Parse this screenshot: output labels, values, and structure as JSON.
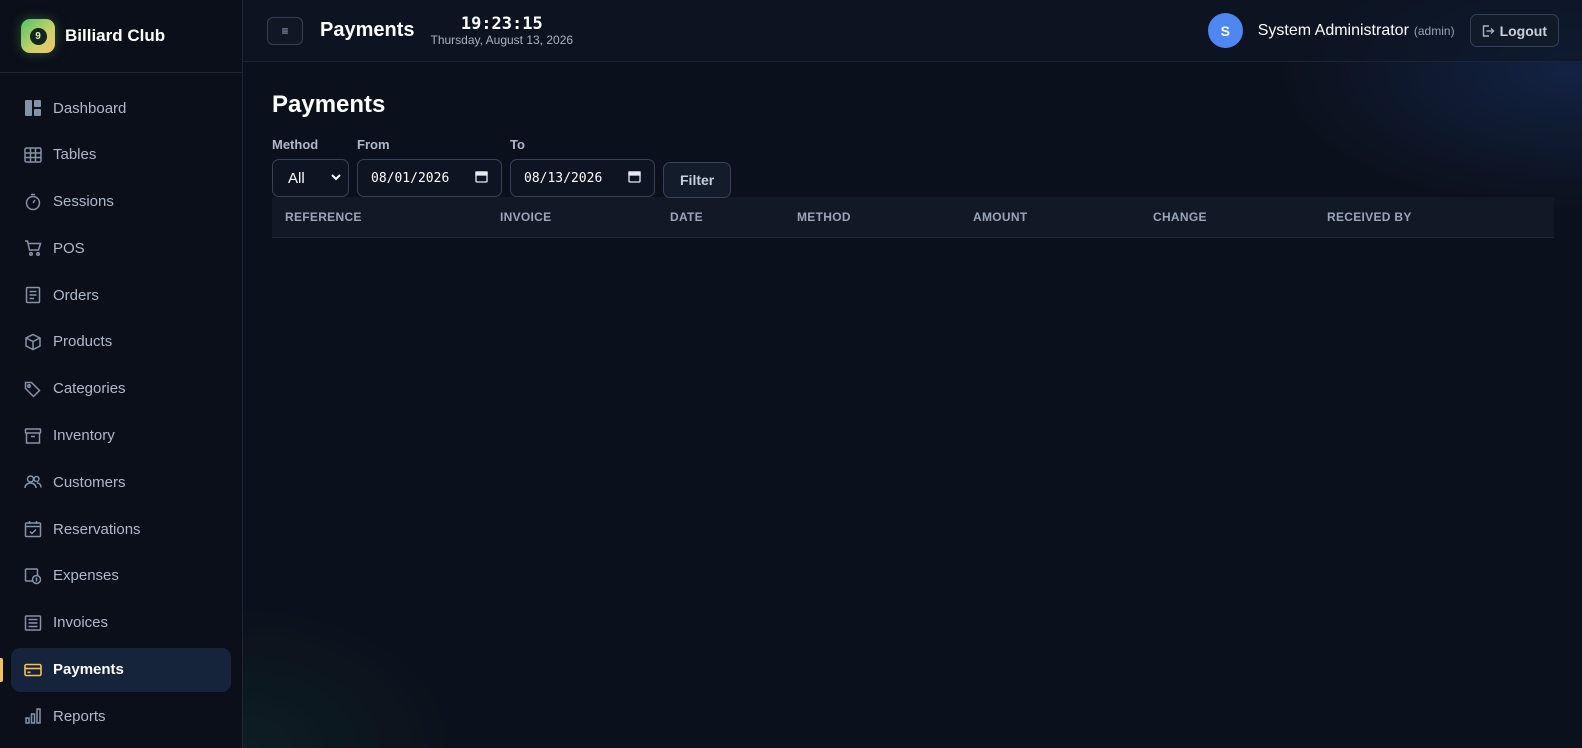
{
  "brand": {
    "name": "Billiard Club",
    "logo_glyph": "9",
    "logo_icon": "billiard-ball-icon"
  },
  "sidebar": {
    "items": [
      {
        "label": "Dashboard",
        "icon": "dashboard-icon"
      },
      {
        "label": "Tables",
        "icon": "table-grid-icon"
      },
      {
        "label": "Sessions",
        "icon": "stopwatch-icon"
      },
      {
        "label": "POS",
        "icon": "cart-icon"
      },
      {
        "label": "Orders",
        "icon": "receipt-icon"
      },
      {
        "label": "Products",
        "icon": "box-icon"
      },
      {
        "label": "Categories",
        "icon": "tag-icon"
      },
      {
        "label": "Inventory",
        "icon": "archive-icon"
      },
      {
        "label": "Customers",
        "icon": "users-icon"
      },
      {
        "label": "Reservations",
        "icon": "calendar-check-icon"
      },
      {
        "label": "Expenses",
        "icon": "expense-icon"
      },
      {
        "label": "Invoices",
        "icon": "invoice-icon"
      },
      {
        "label": "Payments",
        "icon": "credit-card-icon",
        "active": true
      },
      {
        "label": "Reports",
        "icon": "bar-chart-icon"
      }
    ],
    "active_color": "#f1c15c"
  },
  "topbar": {
    "menu_glyph": "≡",
    "title": "Payments",
    "clock_time": "19:23:15",
    "clock_date": "Thursday, August 13, 2026",
    "user_initial": "S",
    "user_name": "System Administrator",
    "user_role": "(admin)",
    "logout_label": "Logout"
  },
  "page": {
    "title": "Payments",
    "filters": {
      "method_label": "Method",
      "method_value": "All",
      "from_label": "From",
      "from_value": "08/01/2026",
      "to_label": "To",
      "to_value": "08/13/2026",
      "filter_button": "Filter"
    },
    "table": {
      "columns": [
        "REFERENCE",
        "INVOICE",
        "DATE",
        "METHOD",
        "AMOUNT",
        "CHANGE",
        "RECEIVED BY"
      ],
      "rows": []
    }
  },
  "colors": {
    "accent": "#f1c15c",
    "avatar": "#4f87f2",
    "background": "#0b111c"
  }
}
